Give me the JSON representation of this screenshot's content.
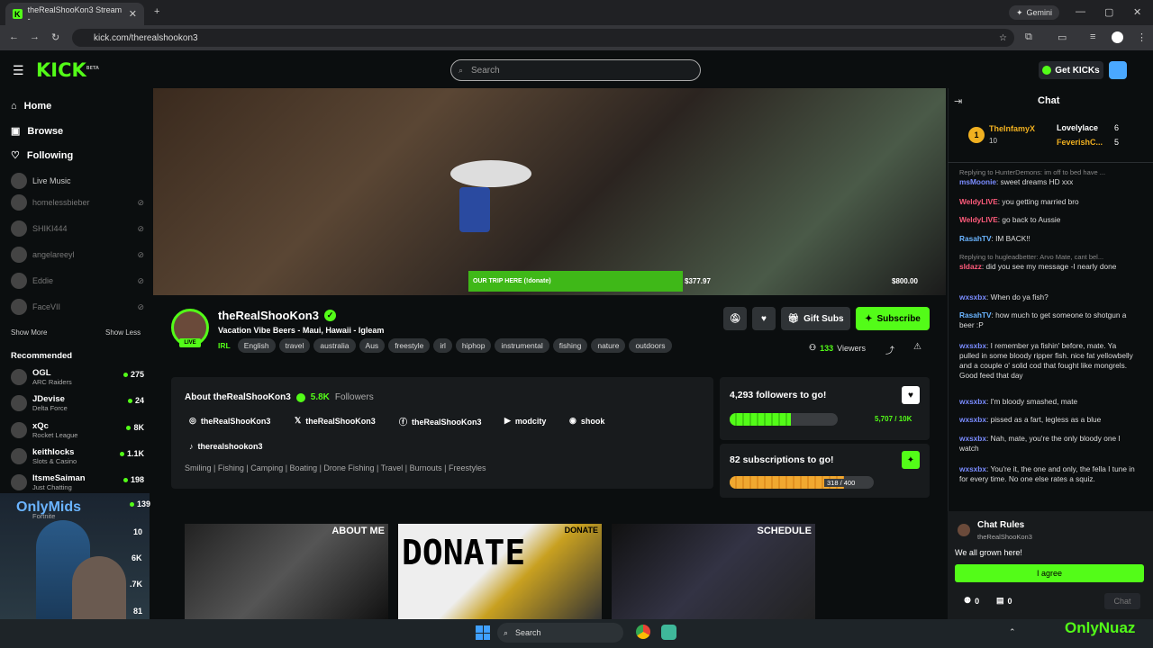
{
  "browser": {
    "tab_title": "theRealShooKon3 Stream -",
    "url": "kick.com/therealshookon3",
    "gemini": "Gemini"
  },
  "header": {
    "logo": "KICK",
    "beta": "BETA",
    "search_placeholder": "Search",
    "get_kicks": "Get KICKs"
  },
  "sidebar": {
    "nav": [
      {
        "label": "Home"
      },
      {
        "label": "Browse"
      },
      {
        "label": "Following"
      }
    ],
    "following": [
      {
        "name": "Live Music"
      },
      {
        "name": "homelessbieber"
      },
      {
        "name": "SHIKI444"
      },
      {
        "name": "angelareeyl"
      },
      {
        "name": "Eddie"
      },
      {
        "name": "FaceVII"
      }
    ],
    "show_more": "Show More",
    "show_less": "Show Less",
    "recommended_title": "Recommended",
    "recommended": [
      {
        "name": "OGL",
        "category": "ARC Raiders",
        "viewers": "275"
      },
      {
        "name": "JDevise",
        "category": "Delta Force",
        "viewers": "24"
      },
      {
        "name": "xQc",
        "category": "Rocket League",
        "viewers": "8K"
      },
      {
        "name": "keithlocks",
        "category": "Slots & Casino",
        "viewers": "1.1K"
      },
      {
        "name": "ItsmeSaiman",
        "category": "Just Chatting",
        "viewers": "198"
      },
      {
        "name": "",
        "category": "Fortnite",
        "viewers": "139"
      }
    ],
    "partial_counts": [
      "10",
      "6K",
      ".7K",
      "81"
    ]
  },
  "video": {
    "goal_label": "OUR TRIP HERE (!donate)",
    "goal_current": "$377.97",
    "goal_target": "$800.00",
    "goal_progress": 0.47
  },
  "channel": {
    "name": "theRealShooKon3",
    "live": "LIVE",
    "title": "Vacation Vibe Beers - Maui, Hawaii - Igleam",
    "category": "IRL",
    "tags": [
      "English",
      "travel",
      "australia",
      "Aus",
      "freestyle",
      "irl",
      "hiphop",
      "instrumental",
      "fishing",
      "nature",
      "outdoors"
    ],
    "gift_subs": "Gift Subs",
    "subscribe": "Subscribe",
    "viewers_count": "133",
    "viewers_label": "Viewers"
  },
  "about": {
    "title": "About theRealShooKon3",
    "followers": "5.8K",
    "followers_label": "Followers",
    "socials": [
      {
        "icon": "instagram-icon",
        "label": "theRealShooKon3"
      },
      {
        "icon": "x-icon",
        "label": "theRealShooKon3"
      },
      {
        "icon": "facebook-icon",
        "label": "theRealShooKon3"
      },
      {
        "icon": "youtube-icon",
        "label": "modcity"
      },
      {
        "icon": "discord-icon",
        "label": "shook"
      },
      {
        "icon": "tiktok-icon",
        "label": "therealshookon3"
      }
    ],
    "keywords": "Smiling | Fishing | Camping | Boating | Drone Fishing | Travel | Burnouts | Freestyles"
  },
  "goals": {
    "followers_title": "4,293 followers to go!",
    "followers_progress": "5,707 / 10K",
    "followers_fraction": 0.57,
    "subs_title": "82 subscriptions to go!",
    "subs_progress": "318 / 400",
    "subs_fraction": 0.795
  },
  "panels": [
    {
      "label": "ABOUT ME"
    },
    {
      "label": "DONATE",
      "big": "DONATE"
    },
    {
      "label": "SCHEDULE"
    }
  ],
  "chat": {
    "title": "Chat",
    "leaderboard": [
      {
        "rank": "1",
        "name": "TheInfamyX",
        "count": "10"
      },
      {
        "name": "Lovelylace",
        "count": "6"
      },
      {
        "name": "FeverishC...",
        "count": "5"
      }
    ],
    "messages": [
      {
        "reply": "Replying to HunterDemons: im off to bed have ...",
        "user": "msMoonie",
        "text": ": sweet dreams HD xxx",
        "cls": "u1"
      },
      {
        "user": "WeldyLIVE",
        "text": ": you getting married bro",
        "cls": "u2"
      },
      {
        "user": "WeldyLIVE",
        "text": ": go back to Aussie",
        "cls": "u2"
      },
      {
        "user": "RasahTV",
        "text": ": IM BACK!!",
        "cls": "u3"
      },
      {
        "reply": "Replying to hugleadbetter: Arvo Mate, cant bel...",
        "user": "sldazz",
        "text": ": did you see my message -I nearly done",
        "cls": "u2"
      },
      {
        "user": "wxsxbx",
        "text": ": When do ya fish?",
        "cls": "u1"
      },
      {
        "user": "RasahTV",
        "text": ": how much to get someone to shotgun a beer :P",
        "cls": "u3"
      },
      {
        "user": "wxsxbx",
        "text": ": I remember ya fishin' before, mate. Ya pulled in some bloody ripper fish. nice fat yellowbelly and a couple o' solid cod that fought like mongrels. Good feed that day",
        "cls": "u1"
      },
      {
        "user": "wxsxbx",
        "text": ": I'm bloody smashed, mate",
        "cls": "u1"
      },
      {
        "user": "wxsxbx",
        "text": ": pissed as a fart, legless as a blue",
        "cls": "u1"
      },
      {
        "user": "wxsxbx",
        "text": ": Nah, mate, you're the only bloody one I watch",
        "cls": "u1"
      },
      {
        "user": "wxsxbx",
        "text": ": You're it, the one and only, the fella I tune in for every time. No one else rates a squiz.",
        "cls": "u1"
      }
    ],
    "rules_title": "Chat Rules",
    "rules_channel": "theRealShooKon3",
    "rules_text": "We all grown here!",
    "agree": "I agree",
    "count1": "0",
    "count2": "0",
    "send": "Chat"
  },
  "overlays": {
    "left": "OnlyMids",
    "right": "OnlyNuaz"
  },
  "taskbar": {
    "search": "Search"
  }
}
